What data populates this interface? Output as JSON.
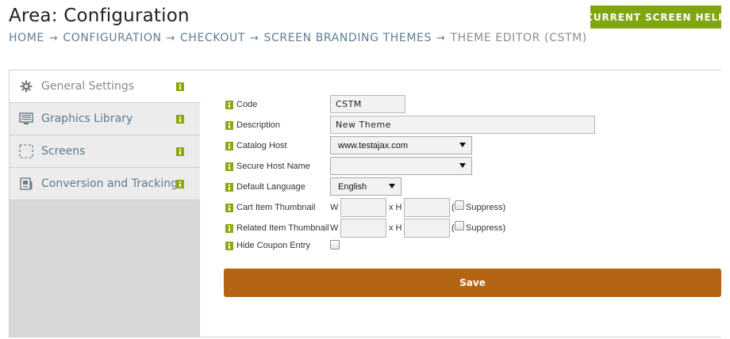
{
  "header": {
    "title": "Area: Configuration",
    "help_button_label": "CURRENT SCREEN HELP"
  },
  "breadcrumb": {
    "items": [
      "HOME",
      "CONFIGURATION",
      "CHECKOUT",
      "SCREEN BRANDING THEMES"
    ],
    "current": "THEME EDITOR (CSTM)",
    "separator": "→"
  },
  "sidebar": {
    "items": [
      {
        "label": "General Settings",
        "icon": "gear-icon",
        "active": true
      },
      {
        "label": "Graphics Library",
        "icon": "monitor-icon",
        "active": false
      },
      {
        "label": "Screens",
        "icon": "dashed-box-icon",
        "active": false
      },
      {
        "label": "Conversion and Tracking",
        "icon": "chart-document-icon",
        "active": false
      }
    ]
  },
  "form": {
    "code": {
      "label": "Code",
      "value": "CSTM"
    },
    "description": {
      "label": "Description",
      "value": "New Theme"
    },
    "catalog_host": {
      "label": "Catalog Host",
      "value": "www.testajax.com"
    },
    "secure_host_name": {
      "label": "Secure Host Name",
      "value": ""
    },
    "default_language": {
      "label": "Default Language",
      "value": "English"
    },
    "cart_item_thumbnail": {
      "label": "Cart Item Thumbnail",
      "w_label": "W",
      "x_label": "x H",
      "suppress_open": "(",
      "suppress_label": "Suppress)",
      "width": "",
      "height": "",
      "suppress": false
    },
    "related_item_thumbnail": {
      "label": "Related Item Thumbnail",
      "w_label": "W",
      "x_label": "x H",
      "suppress_open": "(",
      "suppress_label": "Suppress)",
      "width": "",
      "height": "",
      "suppress": false
    },
    "hide_coupon_entry": {
      "label": "Hide Coupon Entry",
      "checked": false
    },
    "save_label": "Save"
  },
  "colors": {
    "accent_green": "#7fa611",
    "save_orange": "#b46514",
    "link_blue": "#5f7d93",
    "info_icon_green": "#8aa913"
  }
}
